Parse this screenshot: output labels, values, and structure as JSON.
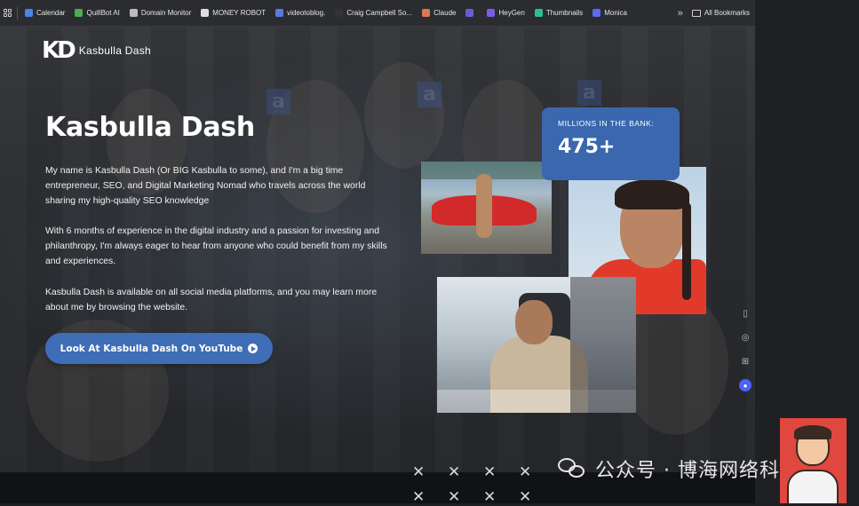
{
  "bookmarks": {
    "items": [
      {
        "label": "Calendar",
        "icon": "calendar-icon",
        "color": "#4a86e8"
      },
      {
        "label": "QuillBot AI",
        "icon": "quillbot-icon",
        "color": "#4caf50"
      },
      {
        "label": "Domain Monitor",
        "icon": "globe-icon",
        "color": "#bdbdbd"
      },
      {
        "label": "MONEY ROBOT",
        "icon": "robot-icon",
        "color": "#dddddd"
      },
      {
        "label": "videotoblog.",
        "icon": "videotoblog-icon",
        "color": "#5b7bd6"
      },
      {
        "label": "Craig Campbell So...",
        "icon": "craig-icon",
        "color": "#333333"
      },
      {
        "label": "Claude",
        "icon": "claude-icon",
        "color": "#d97757"
      },
      {
        "label": "",
        "icon": "s-app-icon",
        "color": "#6b5bd6"
      },
      {
        "label": "HeyGen",
        "icon": "heygen-icon",
        "color": "#7b5ce6"
      },
      {
        "label": "Thumbnails",
        "icon": "thumbnails-icon",
        "color": "#2fbf8f"
      },
      {
        "label": "Monica",
        "icon": "monica-icon",
        "color": "#5b6cf0"
      }
    ],
    "more": "»",
    "all_label": "All Bookmarks"
  },
  "site": {
    "logo_mark": "KD",
    "logo_text": "Kasbulla Dash",
    "title": "Kasbulla Dash",
    "paragraphs": [
      "My name is Kasbulla Dash (Or BIG Kasbulla to some), and I'm a big time entrepreneur, SEO, and Digital Marketing Nomad who travels across the world sharing my high-quality SEO knowledge",
      "With 6 months of experience in the digital industry and a passion for investing and philanthropy, I'm always eager to hear from anyone who could benefit from my skills and experiences.",
      "Kasbulla Dash is available on all social media platforms, and you may learn more about me by browsing the website."
    ],
    "cta_label": "Look At Kasbulla Dash On YouTube",
    "stat_label": "MILLIONS IN THE BANK:",
    "stat_value": "475+",
    "accent_color": "#3f6db6"
  },
  "watermark": {
    "text": "公众号 · 博海网络科技"
  }
}
